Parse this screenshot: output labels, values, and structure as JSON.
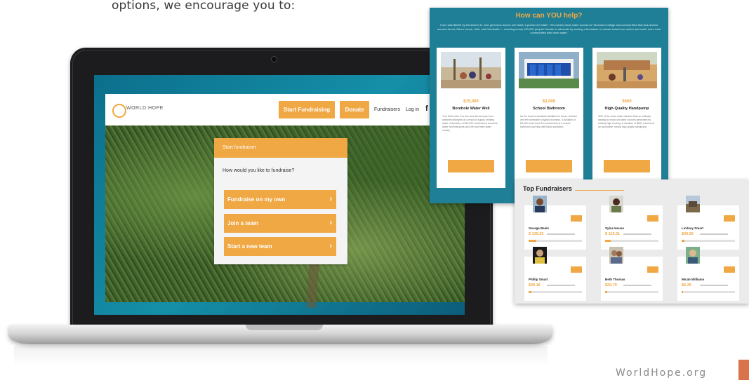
{
  "intro_text": "options, we encourage you to:",
  "site": {
    "logo_text": "WORLD HOPE",
    "header_buttons": {
      "start": "Start Fundraising",
      "donate": "Donate"
    },
    "nav": {
      "fundraisers": "Fundraisers",
      "login": "Log in"
    },
    "social": [
      "f",
      "t"
    ]
  },
  "fundraise_card": {
    "heading": "Start fundraiser",
    "question": "How would you like to fundraise?",
    "options": [
      "Fundraise on my own",
      "Join a team",
      "Start a new team"
    ]
  },
  "help_panel": {
    "title": "How can YOU help?",
    "blurb": "If we raise $5000 by December 31, four generous donors will match a portion for Water. This means clean water access for Tanoloko's village and communities that lack access across Liberia, Sierra Leone, Haiti, and Cambodia — reaching nearly 100,000 people! Donate or advocate by sharing a fundraiser or donate toward our match and reach more rural communities with clean water.",
    "cards": [
      {
        "amount": "$15,000",
        "name": "Borehole Water Well",
        "desc": "Your WHI order Cox thin area 60 seconds from stretched triangles on a result of supply drinking water. A donation of $15,000 could fund a borehole water well that gives pure life and fresh water nearby."
      },
      {
        "amount": "$3,000",
        "name": "School Bathroom",
        "desc": "As the lead for sanitation facilities for areas, children are left vulnerable to typical sickness. A donation of $3,000 could fund the construction of a school bathroom and help with basic sanitation.",
        "price": "$3,000"
      },
      {
        "amount": "$500",
        "name": "High-Quality Handpump",
        "desc": "40% of the clean water handset fails on estimate, starting to repair old water sources generated by unlikely high running. A donation of $500 could fund an accessible, strong high-quality handpump."
      }
    ]
  },
  "fundraisers_panel": {
    "title": "Top Fundraisers",
    "people": [
      {
        "name": "George Beals",
        "amount": "$ 135.25",
        "progress": 0.15
      },
      {
        "name": "Sylus House",
        "amount": "$ 113.31",
        "progress": 0.1
      },
      {
        "name": "Lindsey Smart",
        "amount": "$40.56",
        "progress": 0.05
      },
      {
        "name": "Phillip Smart",
        "amount": "$40.16",
        "progress": 0.05
      },
      {
        "name": "Beth Thomas",
        "amount": "$20.79",
        "progress": 0.04
      },
      {
        "name": "Micah Williams",
        "amount": "$6.36",
        "progress": 0.02
      }
    ]
  },
  "footer": {
    "url": "WorldHope.org"
  },
  "colors": {
    "accent": "#f0a845",
    "teal": "#1f7f97",
    "footer_tab": "#d9744a"
  }
}
